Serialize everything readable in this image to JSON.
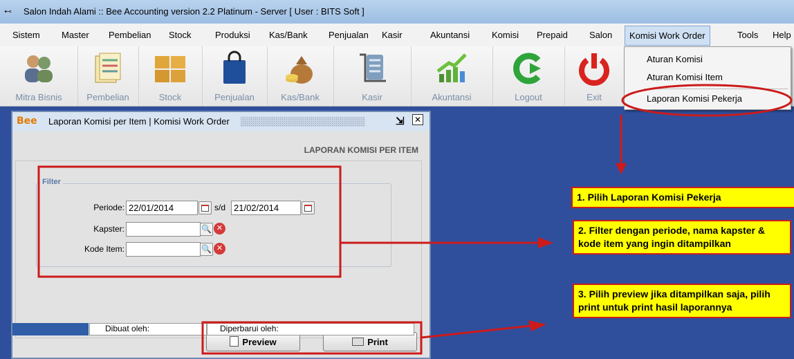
{
  "window_title": "Salon Indah Alami :: Bee Accounting version 2.2 Platinum - Server  [ User : BITS Soft ]",
  "menubar": [
    "Sistem",
    "Master",
    "Pembelian",
    "Stock",
    "Produksi",
    "Kas/Bank",
    "Penjualan",
    "Kasir",
    "Akuntansi",
    "Komisi",
    "Prepaid",
    "Salon",
    "Komisi Work Order",
    "Tools",
    "Help"
  ],
  "toolbar": [
    "Mitra Bisnis",
    "Pembelian",
    "Stock",
    "Penjualan",
    "Kas/Bank",
    "Kasir",
    "Akuntansi",
    "Logout",
    "Exit"
  ],
  "dropdown": [
    "Aturan Komisi",
    "Aturan Komisi Item",
    "Laporan Komisi Pekerja"
  ],
  "report": {
    "window_title": "Laporan Komisi per Item | Komisi Work Order",
    "logo": "Bee",
    "heading": "LAPORAN KOMISI PER ITEM",
    "filter_legend": "Filter",
    "periode_label": "Periode:",
    "periode_from": "22/01/2014",
    "sd_label": "s/d",
    "periode_to": "21/02/2014",
    "kapster_label": "Kapster:",
    "kapster_value": "",
    "kode_item_label": "Kode Item:",
    "kode_item_value": "",
    "preview_label": "Preview",
    "print_label": "Print",
    "created_by": "Dibuat oleh:",
    "updated_by": "Diperbarui oleh:"
  },
  "callouts": [
    "1. Pilih Laporan Komisi Pekerja",
    "2. Filter dengan periode, nama kapster & kode item  yang ingin ditampilkan",
    "3. Pilih preview jika ditampilkan saja, pilih print untuk print hasil laporannya"
  ],
  "colors": {
    "desktop": "#2f4f9c",
    "callout_bg": "#ffff00",
    "annotation_red": "#cc1b1b"
  }
}
